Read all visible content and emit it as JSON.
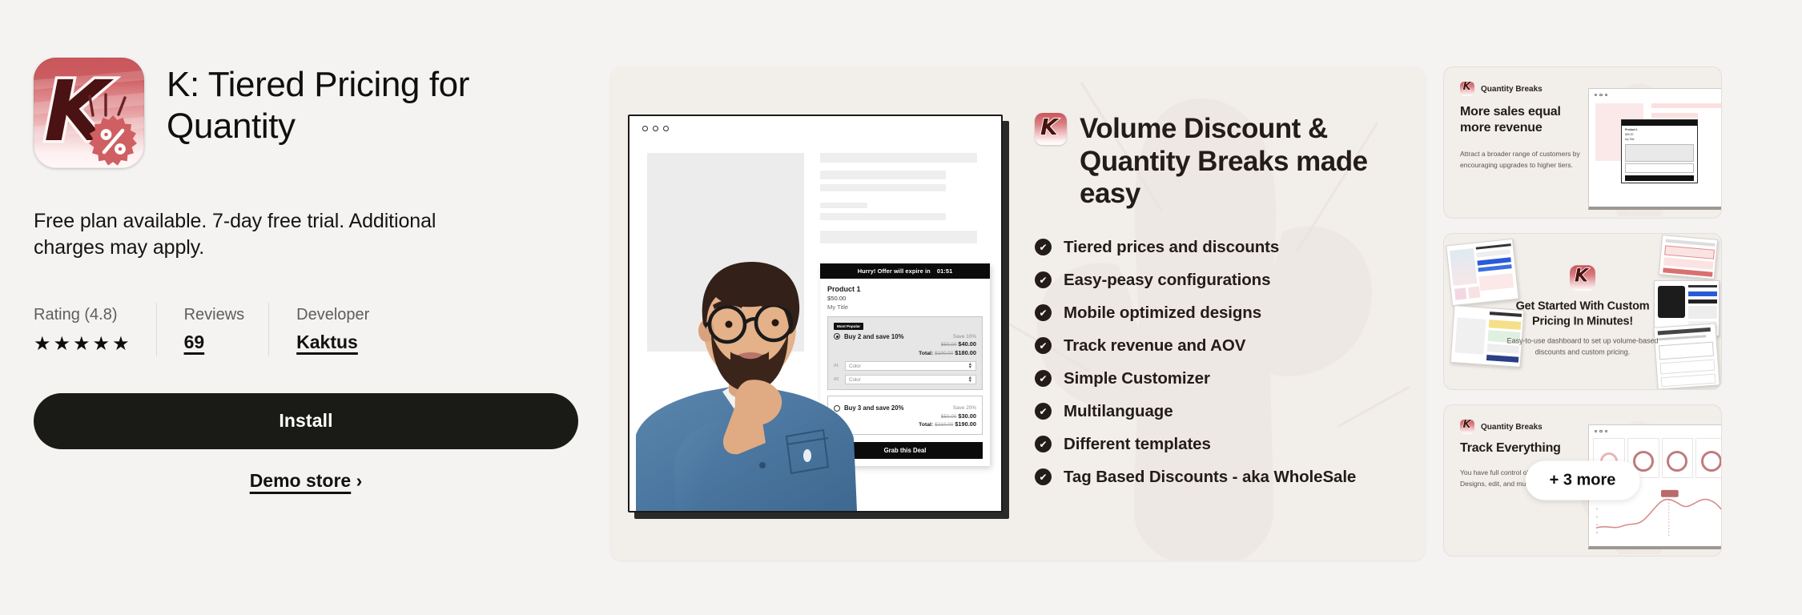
{
  "app": {
    "icon_name": "kaktus-app-icon",
    "icon_letter": "K",
    "title": "K: Tiered Pricing for Quantity",
    "plan_note": "Free plan available. 7-day free trial. Additional charges may apply."
  },
  "meta": {
    "rating_label": "Rating (4.8)",
    "rating_value": 4.8,
    "stars": "★★★★★",
    "reviews_label": "Reviews",
    "reviews_value": "69",
    "developer_label": "Developer",
    "developer_value": "Kaktus"
  },
  "actions": {
    "install_label": "Install",
    "demo_label": "Demo store",
    "demo_chevron": "›"
  },
  "hero": {
    "title": "Volume Discount & Quantity Breaks made easy",
    "icon_letter": "K",
    "features": [
      {
        "label": "Tiered prices and discounts",
        "check": "✔"
      },
      {
        "label": "Easy-peasy configurations",
        "check": "✔"
      },
      {
        "label": "Mobile optimized designs",
        "check": "✔"
      },
      {
        "label": "Track revenue and AOV",
        "check": "✔"
      },
      {
        "label": "Simple Customizer",
        "check": "✔"
      },
      {
        "label": "Multilanguage",
        "check": "✔"
      },
      {
        "label": "Different templates",
        "check": "✔"
      },
      {
        "label": "Tag Based Discounts - aka WholeSale",
        "check": "✔"
      }
    ],
    "mock": {
      "offer_bar_text": "Hurry! Offer will expire in",
      "offer_timer": "01:51",
      "product_name": "Product 1",
      "product_price": "$50.00",
      "product_subtitle": "My Title",
      "badge_most_popular": "Most Popular",
      "tier1": {
        "name": "Buy 2 and save 10%",
        "save": "Save 10%",
        "was": "$50.00",
        "now": "$40.00",
        "total_label": "Total:",
        "total_was": "$190.00",
        "total_now": "$180.00",
        "options": [
          {
            "index": "#1",
            "placeholder": "Color"
          },
          {
            "index": "#2",
            "placeholder": "Color"
          }
        ]
      },
      "tier2": {
        "name": "Buy 3 and save 20%",
        "save": "Save 20%",
        "was": "$50.00",
        "now": "$30.00",
        "total_label": "Total:",
        "total_was": "$210.00",
        "total_now": "$190.00"
      },
      "cta": "Grab this Deal"
    }
  },
  "thumbnails": {
    "more_label": "+ 3 more",
    "items": [
      {
        "brand": "Quantity Breaks",
        "brand_letter": "K",
        "heading": "More sales equal more revenue",
        "body": "Attract a broader range of customers by encouraging upgrades to higher tiers."
      },
      {
        "icon_letter": "K",
        "heading": "Get Started With Custom Pricing In Minutes!",
        "body": "Easy-to-use dashboard to set up volume-based discounts and custom pricing."
      },
      {
        "brand": "Quantity Breaks",
        "brand_letter": "K",
        "heading": "Track Everything",
        "body": "You have full control of the Funnel, from Designs, edit, and much more."
      }
    ]
  },
  "colors": {
    "page_bg": "#f4f3f1",
    "panel_bg": "#f2eeea",
    "ink": "#231c1a",
    "brand_red": "#c9565a",
    "button_black": "#1a1a17"
  }
}
